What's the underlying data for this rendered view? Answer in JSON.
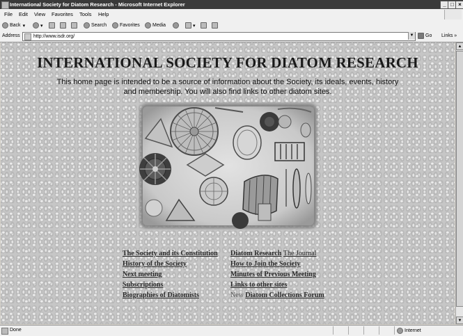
{
  "window": {
    "title": "International Society for Diatom Research - Microsoft Internet Explorer"
  },
  "menu": [
    "File",
    "Edit",
    "View",
    "Favorites",
    "Tools",
    "Help"
  ],
  "toolbar": {
    "back": "Back",
    "search": "Search",
    "favorites": "Favorites",
    "media": "Media"
  },
  "address": {
    "label": "Address",
    "url": "http://www.isdr.org/",
    "go": "Go",
    "links": "Links"
  },
  "page": {
    "title": "INTERNATIONAL SOCIETY FOR DIATOM RESEARCH",
    "intro": "This home page is intended to be a source of information about the Society, its ideals, events, history and membership. You will also find links to other diatom sites.",
    "links_left": [
      "The Society and its Constitution",
      "History of the Society",
      "Next meeting",
      "Subscriptions",
      "Biographies of Diatomists"
    ],
    "links_right": {
      "diatom_research": "Diatom Research",
      "the_journal": "The Journal",
      "how_to_join": "How to Join the Society",
      "minutes": "Minutes of Previous Meeting",
      "links_other": "Links to other sites",
      "new_prefix": "New",
      "collections_forum": "Diatom Collections Forum"
    }
  },
  "status": {
    "text": "Done",
    "zone": "Internet"
  }
}
